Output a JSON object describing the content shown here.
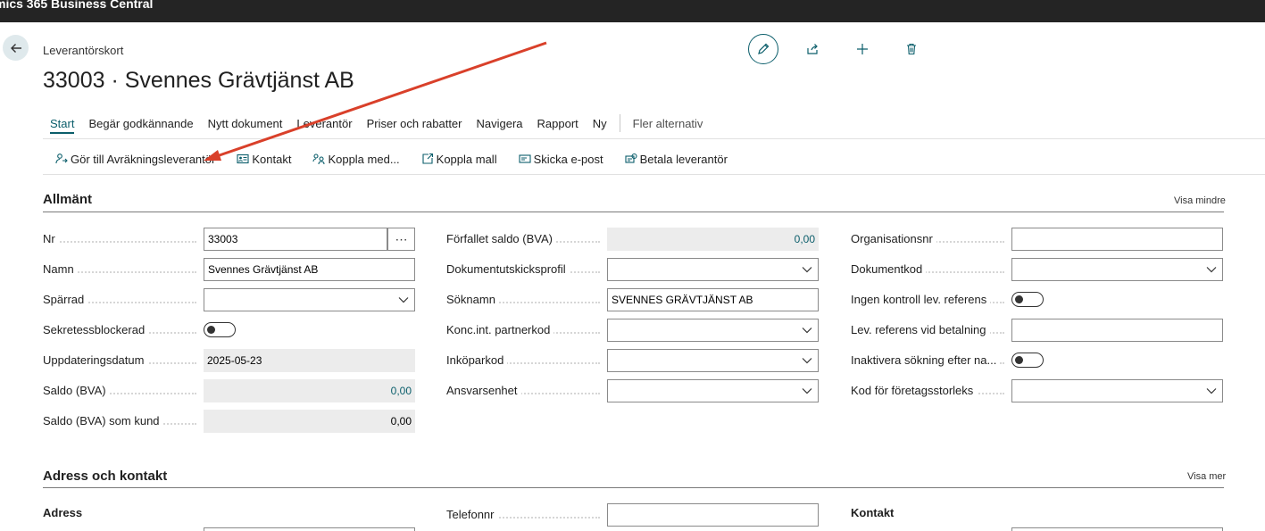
{
  "app": {
    "title": "mics 365 Business Central"
  },
  "header": {
    "page_type": "Leverantörskort",
    "title": "33003 · Svennes Grävtjänst AB"
  },
  "toolbar_icons": [
    "edit-icon",
    "share-icon",
    "add-icon",
    "delete-icon"
  ],
  "tabs": [
    {
      "label": "Start",
      "active": true
    },
    {
      "label": "Begär godkännande"
    },
    {
      "label": "Nytt dokument"
    },
    {
      "label": "Leverantör"
    },
    {
      "label": "Priser och rabatter"
    },
    {
      "label": "Navigera"
    },
    {
      "label": "Rapport"
    },
    {
      "label": "Ny"
    },
    {
      "label": "Fler alternativ"
    }
  ],
  "actions": [
    {
      "label": "Gör till Avräkningsleverantör",
      "icon": "person-swap-icon"
    },
    {
      "label": "Kontakt",
      "icon": "contact-card-icon"
    },
    {
      "label": "Koppla med...",
      "icon": "link-people-icon"
    },
    {
      "label": "Koppla mall",
      "icon": "template-icon"
    },
    {
      "label": "Skicka e-post",
      "icon": "mail-icon"
    },
    {
      "label": "Betala leverantör",
      "icon": "payment-icon"
    }
  ],
  "sections": {
    "general": {
      "title": "Allmänt",
      "toggle_label": "Visa mindre",
      "col1": {
        "nr": {
          "label": "Nr",
          "value": "33003"
        },
        "namn": {
          "label": "Namn",
          "value": "Svennes Grävtjänst AB"
        },
        "sparrad": {
          "label": "Spärrad",
          "value": ""
        },
        "sekretess": {
          "label": "Sekretessblockerad",
          "value": false
        },
        "uppdatering": {
          "label": "Uppdateringsdatum",
          "value": "2025-05-23"
        },
        "saldo": {
          "label": "Saldo (BVA)",
          "value": "0,00"
        },
        "saldo_kund": {
          "label": "Saldo (BVA) som kund",
          "value": "0,00"
        }
      },
      "col2": {
        "forfallet": {
          "label": "Förfallet saldo (BVA)",
          "value": "0,00"
        },
        "dokprofil": {
          "label": "Dokumentutskicksprofil",
          "value": ""
        },
        "soknamn": {
          "label": "Söknamn",
          "value": "SVENNES GRÄVTJÄNST AB"
        },
        "partnerkod": {
          "label": "Konc.int. partnerkod",
          "value": ""
        },
        "inkoparkod": {
          "label": "Inköparkod",
          "value": ""
        },
        "ansvar": {
          "label": "Ansvarsenhet",
          "value": ""
        }
      },
      "col3": {
        "orgnr": {
          "label": "Organisationsnr",
          "value": ""
        },
        "dokkod": {
          "label": "Dokumentkod",
          "value": ""
        },
        "ingen_kontroll": {
          "label": "Ingen kontroll lev. referens",
          "value": false
        },
        "lev_ref": {
          "label": "Lev. referens vid betalning",
          "value": ""
        },
        "inaktivera": {
          "label": "Inaktivera sökning efter na...",
          "value": false
        },
        "storlek": {
          "label": "Kod för företagsstorleks",
          "value": ""
        }
      }
    },
    "address": {
      "title": "Adress och kontakt",
      "toggle_label": "Visa mer",
      "adress_heading": "Adress",
      "telefon": {
        "label": "Telefonnr",
        "value": ""
      },
      "kontakt_heading": "Kontakt"
    }
  },
  "annotation_color": "#d9402a"
}
